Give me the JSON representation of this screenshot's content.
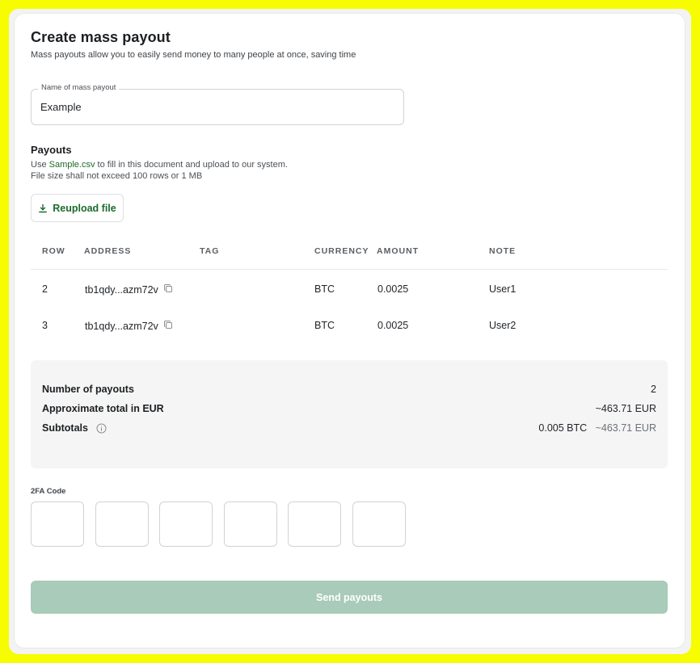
{
  "header": {
    "title": "Create mass payout",
    "subtitle": "Mass payouts allow you to easily send money to many people at once, saving time"
  },
  "name_field": {
    "label": "Name of mass payout",
    "value": "Example"
  },
  "payouts": {
    "title": "Payouts",
    "hint_prefix": "Use ",
    "hint_link": "Sample.csv",
    "hint_suffix": " to fill in this document and upload to our system.",
    "hint_line2": "File size shall not exceed 100 rows or 1 MB",
    "reupload_label": "Reupload file"
  },
  "table": {
    "columns": [
      "ROW",
      "ADDRESS",
      "TAG",
      "CURRENCY",
      "AMOUNT",
      "NOTE"
    ],
    "rows": [
      {
        "row": "2",
        "address": "tb1qdy...azm72v",
        "tag": "",
        "currency": "BTC",
        "amount": "0.0025",
        "note": "User1"
      },
      {
        "row": "3",
        "address": "tb1qdy...azm72v",
        "tag": "",
        "currency": "BTC",
        "amount": "0.0025",
        "note": "User2"
      }
    ]
  },
  "summary": {
    "count_label": "Number of payouts",
    "count_value": "2",
    "total_label": "Approximate total in EUR",
    "total_value": "~463.71 EUR",
    "subtotals_label": "Subtotals",
    "subtotal_crypto": "0.005 BTC",
    "subtotal_fiat": "~463.71 EUR"
  },
  "twofa": {
    "label": "2FA Code",
    "digits": [
      "",
      "",
      "",
      "",
      "",
      ""
    ]
  },
  "send_button": {
    "label": "Send payouts"
  },
  "colors": {
    "background": "#f7fc00",
    "accent": "#1b6b2a",
    "send_disabled": "#a9cbb9"
  },
  "icons": [
    "download-icon",
    "copy-icon",
    "info-icon"
  ]
}
